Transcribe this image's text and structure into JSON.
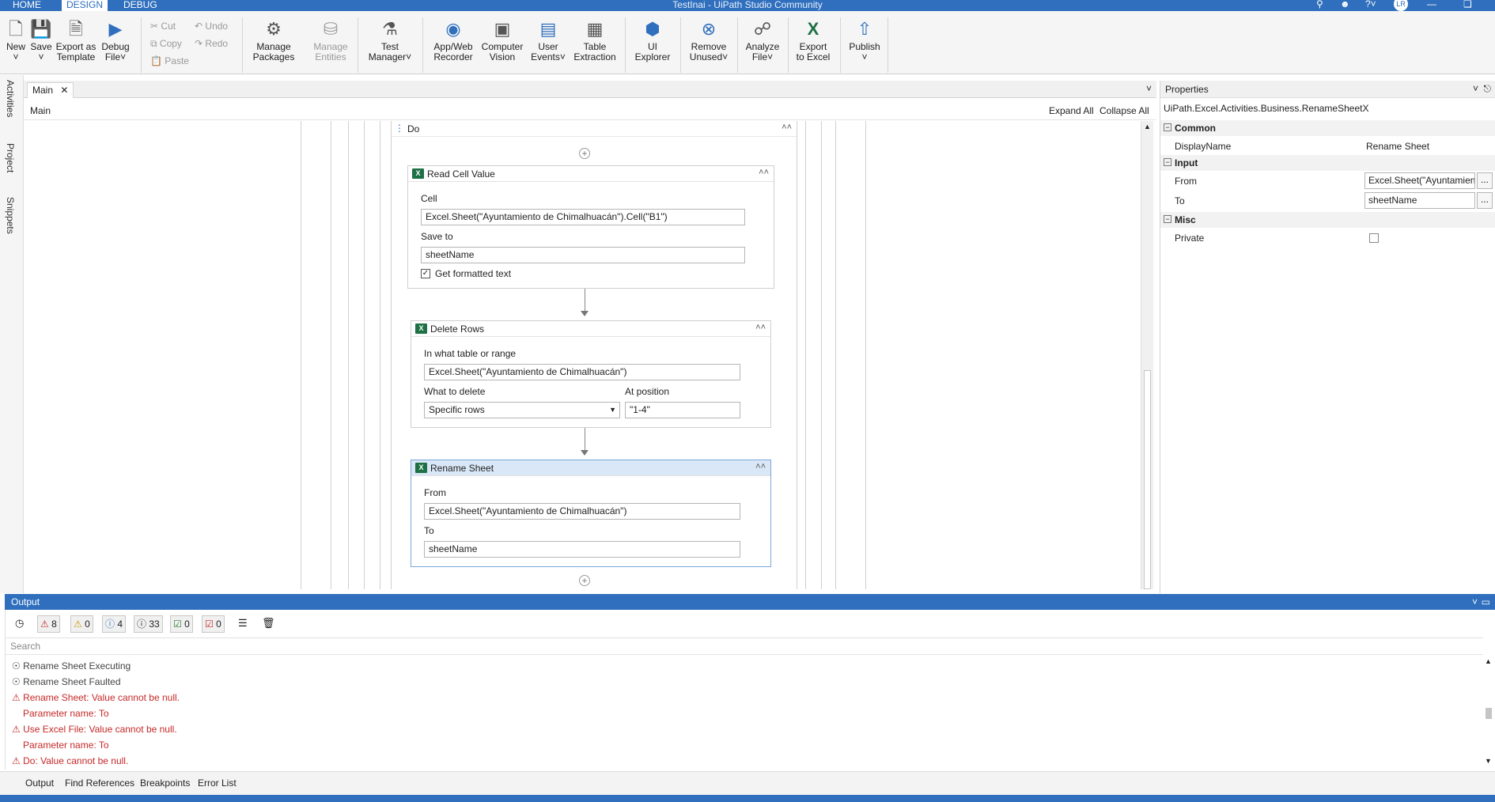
{
  "titlebar": {
    "tabs": [
      "HOME",
      "DESIGN",
      "DEBUG"
    ],
    "active_tab": "DESIGN",
    "window_title": "TestInai - UiPath Studio Community",
    "user_initials": "LR"
  },
  "ribbon": {
    "new": "New",
    "save": "Save",
    "export_template_1": "Export as",
    "export_template_2": "Template",
    "debug_1": "Debug",
    "debug_2": "File",
    "cut": "Cut",
    "copy": "Copy",
    "paste": "Paste",
    "undo": "Undo",
    "redo": "Redo",
    "manage_packages_1": "Manage",
    "manage_packages_2": "Packages",
    "manage_entities_1": "Manage",
    "manage_entities_2": "Entities",
    "test_manager_1": "Test",
    "test_manager_2": "Manager",
    "recorder_1": "App/Web",
    "recorder_2": "Recorder",
    "cv_1": "Computer",
    "cv_2": "Vision",
    "user_events_1": "User",
    "user_events_2": "Events",
    "table_extraction_1": "Table",
    "table_extraction_2": "Extraction",
    "ui_explorer_1": "UI",
    "ui_explorer_2": "Explorer",
    "remove_unused_1": "Remove",
    "remove_unused_2": "Unused",
    "analyze_1": "Analyze",
    "analyze_2": "File",
    "export_excel_1": "Export",
    "export_excel_2": "to Excel",
    "publish": "Publish"
  },
  "left_dock": [
    "Activities",
    "Project",
    "Snippets"
  ],
  "document": {
    "tab": "Main",
    "breadcrumb": "Main",
    "expand_all": "Expand All",
    "collapse_all": "Collapse All"
  },
  "workflow": {
    "do_label": "Do",
    "read_cell": {
      "title": "Read Cell Value",
      "cell_label": "Cell",
      "cell_value": "Excel.Sheet(\"Ayuntamiento de Chimalhuacán\").Cell(\"B1\")",
      "save_to_label": "Save to",
      "save_to_value": "sheetName",
      "formatted_label": "Get formatted text"
    },
    "delete_rows": {
      "title": "Delete Rows",
      "range_label": "In what table or range",
      "range_value": "Excel.Sheet(\"Ayuntamiento de Chimalhuacán\")",
      "what_label": "What to delete",
      "what_value": "Specific rows",
      "position_label": "At position",
      "position_value": "\"1-4\""
    },
    "rename_sheet": {
      "title": "Rename Sheet",
      "from_label": "From",
      "from_value": "Excel.Sheet(\"Ayuntamiento de Chimalhuacán\")",
      "to_label": "To",
      "to_value": "sheetName"
    }
  },
  "properties": {
    "title": "Properties",
    "class_name": "UiPath.Excel.Activities.Business.RenameSheetX",
    "common": "Common",
    "display_name_label": "DisplayName",
    "display_name_value": "Rename Sheet",
    "input": "Input",
    "from_label": "From",
    "from_value": "Excel.Sheet(\"Ayuntamien",
    "to_label": "To",
    "to_value": "sheetName",
    "misc": "Misc",
    "private_label": "Private",
    "ellipsis": "..."
  },
  "output": {
    "title": "Output",
    "counts": {
      "errors": "8",
      "warnings": "0",
      "info": "4",
      "trace": "33",
      "success": "0",
      "failed": "0"
    },
    "search_placeholder": "Search",
    "logs": [
      {
        "text": "Rename Sheet Executing",
        "kind": "info"
      },
      {
        "text": "Rename Sheet Faulted",
        "kind": "info"
      },
      {
        "text": "Rename Sheet: Value cannot be null.",
        "kind": "err"
      },
      {
        "text": "Parameter name: To",
        "kind": "err-indent"
      },
      {
        "text": "Use Excel File: Value cannot be null.",
        "kind": "err"
      },
      {
        "text": "Parameter name: To",
        "kind": "err-indent"
      },
      {
        "text": "Do: Value cannot be null.",
        "kind": "err"
      }
    ]
  },
  "bottom_tabs": [
    "Output",
    "Find References",
    "Breakpoints",
    "Error List"
  ],
  "colors": {
    "accent": "#2f6fbd",
    "error": "#c62828",
    "excel": "#1e7145"
  }
}
